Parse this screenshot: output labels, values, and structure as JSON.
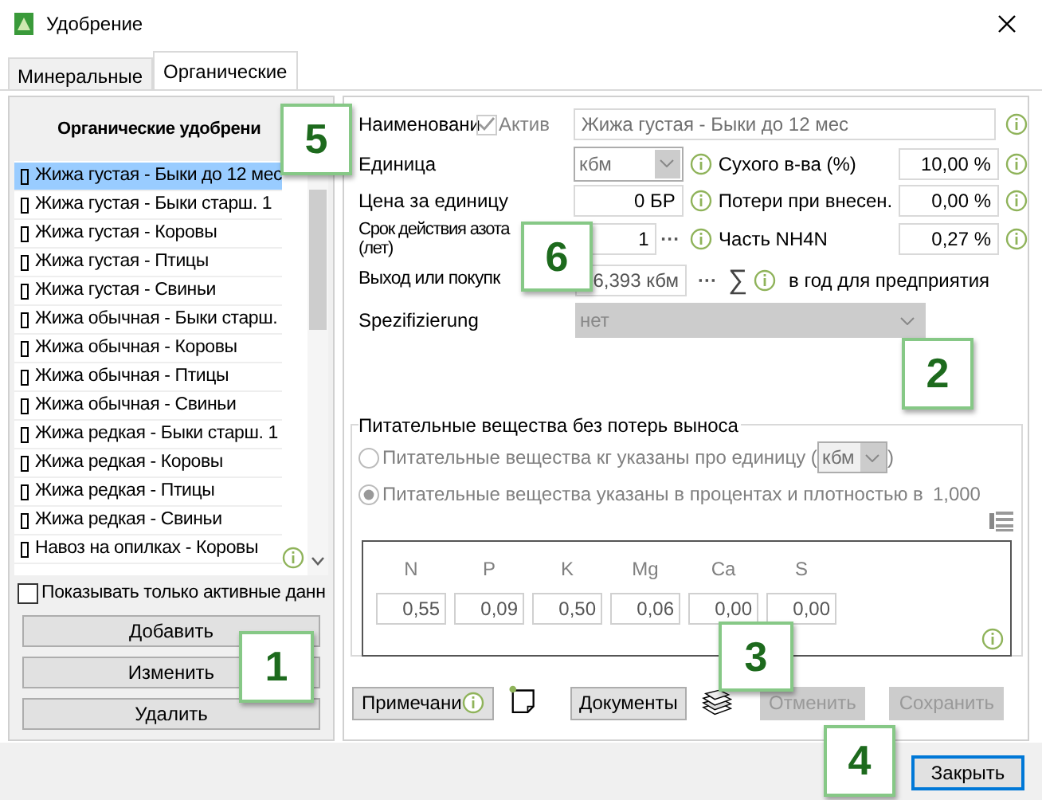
{
  "window": {
    "title": "Удобрение"
  },
  "tabs": [
    {
      "label": "Минеральные",
      "selected": false
    },
    {
      "label": "Органические",
      "selected": true
    }
  ],
  "list": {
    "header": "Органические удобрени",
    "items": [
      {
        "label": "Жижа густая - Быки до 12 мес",
        "selected": true
      },
      {
        "label": "Жижа густая - Быки старш. 1",
        "selected": false
      },
      {
        "label": "Жижа густая - Коровы",
        "selected": false
      },
      {
        "label": "Жижа густая - Птицы",
        "selected": false
      },
      {
        "label": "Жижа густая - Свиньи",
        "selected": false
      },
      {
        "label": "Жижа обычная - Быки старш.",
        "selected": false
      },
      {
        "label": "Жижа обычная - Коровы",
        "selected": false
      },
      {
        "label": "Жижа обычная - Птицы",
        "selected": false
      },
      {
        "label": "Жижа обычная - Свиньи",
        "selected": false
      },
      {
        "label": "Жижа редкая - Быки старш. 1",
        "selected": false
      },
      {
        "label": "Жижа редкая - Коровы",
        "selected": false
      },
      {
        "label": "Жижа редкая - Птицы",
        "selected": false
      },
      {
        "label": "Жижа редкая - Свиньи",
        "selected": false
      },
      {
        "label": "Навоз на опилках - Коровы",
        "selected": false
      }
    ]
  },
  "show_active_only": {
    "label": "Показывать только активные данн",
    "checked": false
  },
  "left_buttons": [
    "Добавить",
    "Изменить",
    "Удалить"
  ],
  "form": {
    "name_label": "Наименовани",
    "active": {
      "label": "Актив",
      "checked": true
    },
    "name_value": "Жижа густая - Быки до 12 мес",
    "unit": {
      "label": "Единица",
      "value": "кбм"
    },
    "price": {
      "label": "Цена за единицу",
      "value": "0 БР"
    },
    "nitrogen_term": {
      "label": "Срок действия азота (лет)",
      "value": "1",
      "more": "···"
    },
    "output": {
      "label": "Выход или покупк",
      "value": "6,393 кбм",
      "more": "···",
      "sum": "∑",
      "suffix": "в год для предприятия"
    },
    "spec": {
      "label": "Spezifizierung",
      "value": "нет"
    },
    "right_fields": [
      {
        "label": "Сухого в-ва (%)",
        "value": "10,00 %"
      },
      {
        "label": "Потери при внесен.",
        "value": "0,00 %"
      },
      {
        "label": "Часть NH4N",
        "value": "0,27 %"
      }
    ]
  },
  "nutrients": {
    "title": "Питательные вещества без потерь выноса",
    "options": [
      {
        "label": "Питательные вещества кг указаны про единицу (",
        "unit": "кбм",
        "suffix": ")",
        "selected": false
      },
      {
        "label": "Питательные вещества указаны в процентах и плотностью в",
        "value": "1,000",
        "selected": true
      }
    ],
    "columns": [
      {
        "name": "N",
        "value": "0,55"
      },
      {
        "name": "P",
        "value": "0,09"
      },
      {
        "name": "K",
        "value": "0,50"
      },
      {
        "name": "Mg",
        "value": "0,06"
      },
      {
        "name": "Ca",
        "value": "0,00"
      },
      {
        "name": "S",
        "value": "0,00"
      }
    ]
  },
  "bottom_buttons": [
    {
      "kind": "note",
      "label": "Примечани",
      "disabled": false
    },
    {
      "kind": "docs",
      "label": "Документы",
      "disabled": false
    },
    {
      "kind": "plain",
      "label": "Отменить",
      "disabled": true
    },
    {
      "kind": "plain",
      "label": "Сохранить",
      "disabled": true
    }
  ],
  "close_button": "Закрыть",
  "callouts": [
    "5",
    "6",
    "2",
    "1",
    "3",
    "4"
  ]
}
